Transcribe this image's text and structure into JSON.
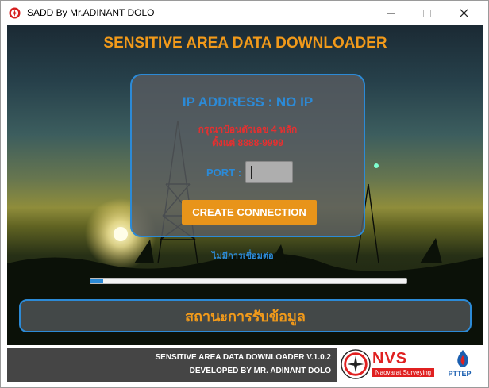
{
  "window": {
    "title": "SADD By Mr.ADINANT DOLO"
  },
  "header": {
    "title": "SENSITIVE AREA DATA DOWNLOADER"
  },
  "connection_panel": {
    "ip_text": "IP ADDRESS : NO IP",
    "warning_line1": "กรุณาป้อนตัวเลข 4 หลัก",
    "warning_line2": "ตั้งแต่ 8888-9999",
    "port_label": "PORT :",
    "port_value": "",
    "create_button": "CREATE CONNECTION"
  },
  "status": {
    "small_text": "ไม่มีการเชื่อมต่อ",
    "progress": 0.04,
    "main_text": "สถานะการรับข้อมูล"
  },
  "footer": {
    "line1": "SENSITIVE AREA DATA DOWNLOADER V.1.0.2",
    "line2": "DEVELOPED BY MR. ADINANT DOLO",
    "nvs_logo_text": "NVS",
    "nvs_subtitle": "Naovarat Surveying",
    "pttep_logo_text": "PTTEP"
  },
  "colors": {
    "accent_orange": "#f29a1a",
    "accent_blue": "#2c8ad6",
    "warning_red": "#e53030"
  }
}
